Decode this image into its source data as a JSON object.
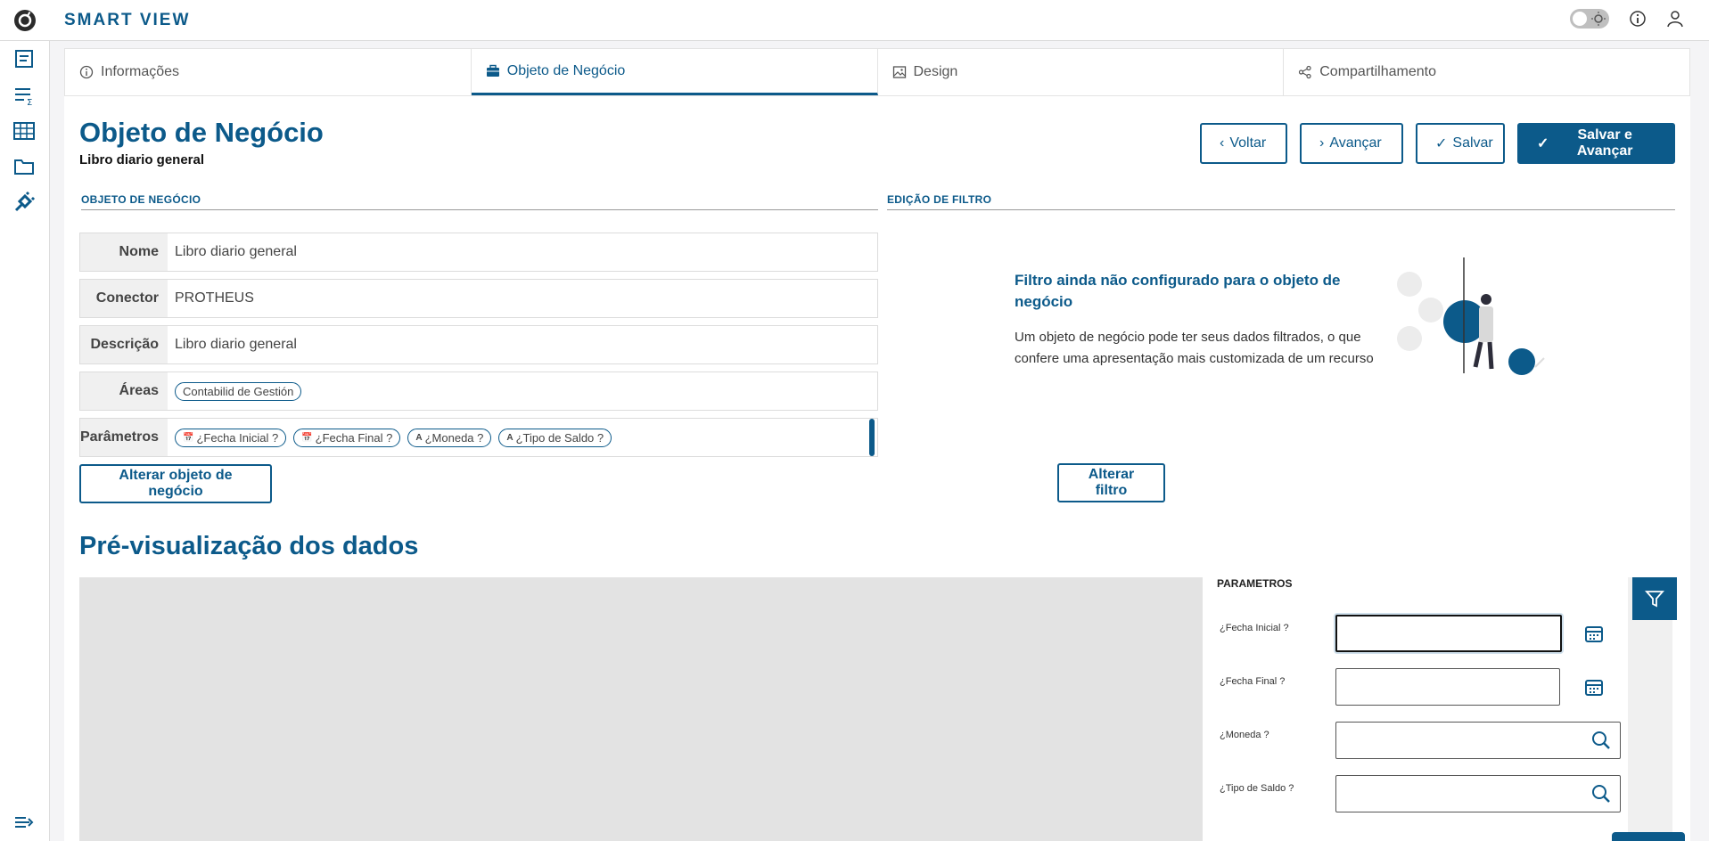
{
  "app": {
    "title": "SMART VIEW"
  },
  "tabs": [
    {
      "label": "Informações",
      "icon": "info-icon"
    },
    {
      "label": "Objeto de Negócio",
      "icon": "briefcase-icon",
      "active": true
    },
    {
      "label": "Design",
      "icon": "image-icon"
    },
    {
      "label": "Compartilhamento",
      "icon": "share-icon"
    }
  ],
  "page": {
    "title": "Objeto de Negócio",
    "subtitle": "Libro diario general"
  },
  "actions": {
    "back": "Voltar",
    "next": "Avançar",
    "save": "Salvar",
    "save_next": "Salvar e Avançar"
  },
  "business_object": {
    "section_label": "OBJETO DE NEGÓCIO",
    "fields": {
      "name_label": "Nome",
      "name_value": "Libro diario general",
      "connector_label": "Conector",
      "connector_value": "PROTHEUS",
      "description_label": "Descrição",
      "description_value": "Libro diario general",
      "areas_label": "Áreas",
      "area_chip": "Contabilid de Gestión",
      "params_label": "Parâmetros",
      "param_chips": [
        "¿Fecha Inicial ?",
        "¿Fecha Final ?",
        "¿Moneda ?",
        "¿Tipo de Saldo ?"
      ],
      "chip_text_icon": "A"
    },
    "change_button": "Alterar objeto de negócio"
  },
  "filter": {
    "section_label": "EDIÇÃO DE FILTRO",
    "empty_title": "Filtro ainda não configurado para o objeto de negócio",
    "empty_text": "Um objeto de negócio pode ter seus dados filtrados, o que confere uma apresentação mais customizada de um recurso",
    "change_button": "Alterar filtro"
  },
  "preview": {
    "title": "Pré-visualização dos dados",
    "params_heading": "PARAMETROS",
    "params": [
      "¿Fecha Inicial ?",
      "¿Fecha Final ?",
      "¿Moneda ?",
      "¿Tipo de Saldo ?"
    ]
  },
  "colors": {
    "primary": "#0c5a8a",
    "preview_bg": "#e3e3e3"
  }
}
